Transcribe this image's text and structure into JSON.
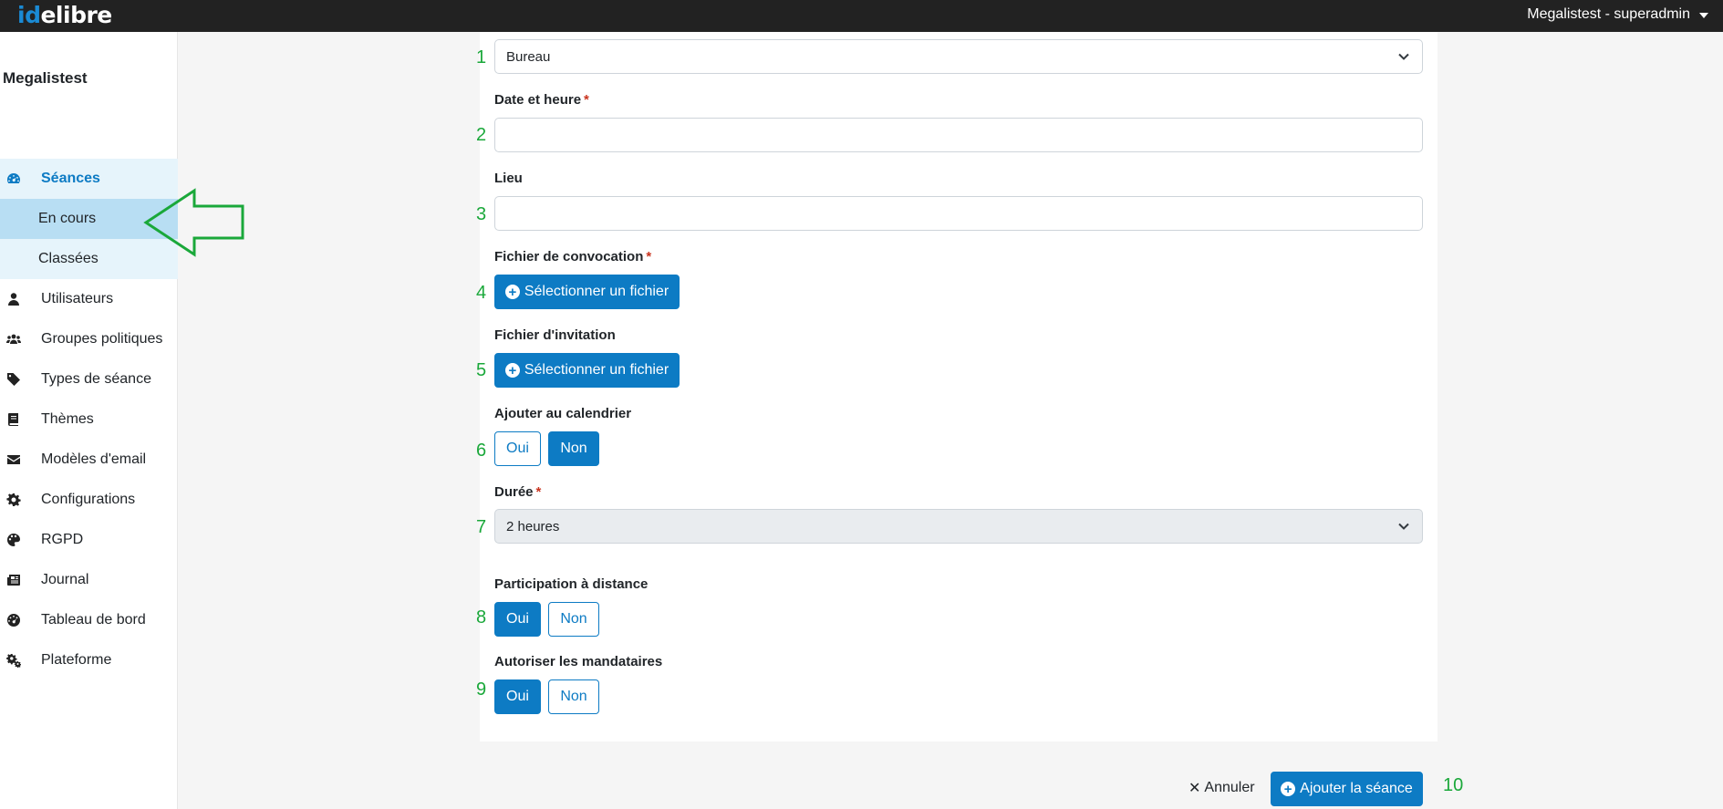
{
  "brand": {
    "part1": "id",
    "part2": "elibre"
  },
  "header": {
    "user_menu": "Megalistest - superadmin"
  },
  "sidebar": {
    "org_name": "Megalistest",
    "items": [
      {
        "label": "Séances",
        "icon": "dashboard-icon"
      },
      {
        "label": "En cours"
      },
      {
        "label": "Classées"
      },
      {
        "label": "Utilisateurs",
        "icon": "user-icon"
      },
      {
        "label": "Groupes politiques",
        "icon": "users-icon"
      },
      {
        "label": "Types de séance",
        "icon": "tag-icon"
      },
      {
        "label": "Thèmes",
        "icon": "book-icon"
      },
      {
        "label": "Modèles d'email",
        "icon": "envelope-icon"
      },
      {
        "label": "Configurations",
        "icon": "gear-icon"
      },
      {
        "label": "RGPD",
        "icon": "palette-icon"
      },
      {
        "label": "Journal",
        "icon": "newspaper-icon"
      },
      {
        "label": "Tableau de bord",
        "icon": "gauge-icon"
      },
      {
        "label": "Plateforme",
        "icon": "gears-icon"
      }
    ]
  },
  "annotations": [
    "1",
    "2",
    "3",
    "4",
    "5",
    "6",
    "7",
    "8",
    "9",
    "10"
  ],
  "form": {
    "type_select_value": "Bureau",
    "date_label": "Date et heure",
    "place_label": "Lieu",
    "convocation_label": "Fichier de convocation",
    "invitation_label": "Fichier d'invitation",
    "select_file_label": "Sélectionner un fichier",
    "calendar_label": "Ajouter au calendrier",
    "duration_label": "Durée",
    "duration_value": "2 heures",
    "remote_label": "Participation à distance",
    "proxy_label": "Autoriser les mandataires",
    "yes": "Oui",
    "no": "Non",
    "required_mark": "*",
    "calendar_selected": "Non",
    "remote_selected": "Oui",
    "proxy_selected": "Oui"
  },
  "footer": {
    "cancel_label": "Annuler",
    "submit_label": "Ajouter la séance"
  },
  "colors": {
    "primary": "#0d7bc4",
    "annotation": "#1aa83a",
    "required": "#c9341f"
  }
}
